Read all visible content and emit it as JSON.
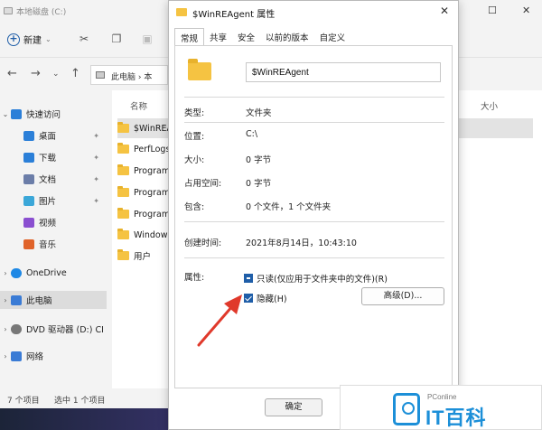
{
  "explorer": {
    "title": "本地磁盘 (C:)",
    "toolbar": {
      "new_label": "新建"
    },
    "address": "此电脑 › 本",
    "columns": {
      "name": "名称",
      "size": "大小"
    },
    "sidebar": [
      {
        "label": "快速访问",
        "icon": "star-icon",
        "color": "#2b7fd8"
      },
      {
        "label": "桌面",
        "icon": "desktop-icon",
        "color": "#2b7fd8",
        "pinned": true
      },
      {
        "label": "下载",
        "icon": "download-icon",
        "color": "#2b7fd8",
        "pinned": true
      },
      {
        "label": "文档",
        "icon": "document-icon",
        "color": "#6b7da8",
        "pinned": true
      },
      {
        "label": "图片",
        "icon": "picture-icon",
        "color": "#3ba7d8",
        "pinned": true
      },
      {
        "label": "视频",
        "icon": "video-icon",
        "color": "#8a4fd0"
      },
      {
        "label": "音乐",
        "icon": "music-icon",
        "color": "#e0632a"
      },
      {
        "label": "OneDrive",
        "icon": "cloud-icon",
        "color": "#1e88e5"
      },
      {
        "label": "此电脑",
        "icon": "computer-icon",
        "color": "#3a7bd5"
      },
      {
        "label": "DVD 驱动器 (D:) CI",
        "icon": "dvd-icon",
        "color": "#777777"
      },
      {
        "label": "网络",
        "icon": "network-icon",
        "color": "#3a7bd5"
      }
    ],
    "files": [
      {
        "name": "$WinREA"
      },
      {
        "name": "PerfLogs"
      },
      {
        "name": "Program"
      },
      {
        "name": "Program"
      },
      {
        "name": "Program"
      },
      {
        "name": "Windows"
      },
      {
        "name": "用户"
      }
    ],
    "status": {
      "count": "7 个项目",
      "selected": "选中 1 个项目"
    }
  },
  "dialog": {
    "title": "$WinREAgent 属性",
    "tabs": [
      "常规",
      "共享",
      "安全",
      "以前的版本",
      "自定义"
    ],
    "folder_name": "$WinREAgent",
    "properties": {
      "type_label": "类型:",
      "type_value": "文件夹",
      "location_label": "位置:",
      "location_value": "C:\\",
      "size_label": "大小:",
      "size_value": "0 字节",
      "disk_label": "占用空间:",
      "disk_value": "0 字节",
      "contains_label": "包含:",
      "contains_value": "0 个文件，1 个文件夹",
      "created_label": "创建时间:",
      "created_value": "2021年8月14日，10:43:10",
      "attributes_label": "属性:"
    },
    "readonly_label": "只读(仅应用于文件夹中的文件)(R)",
    "hidden_label": "隐藏(H)",
    "advanced_label": "高级(D)...",
    "ok_label": "确定"
  },
  "watermark": {
    "small": "PConline",
    "big": "IT百科"
  },
  "colors": {
    "accent": "#1f5ea8",
    "folder": "#f5c342",
    "arrow": "#e0392b"
  }
}
